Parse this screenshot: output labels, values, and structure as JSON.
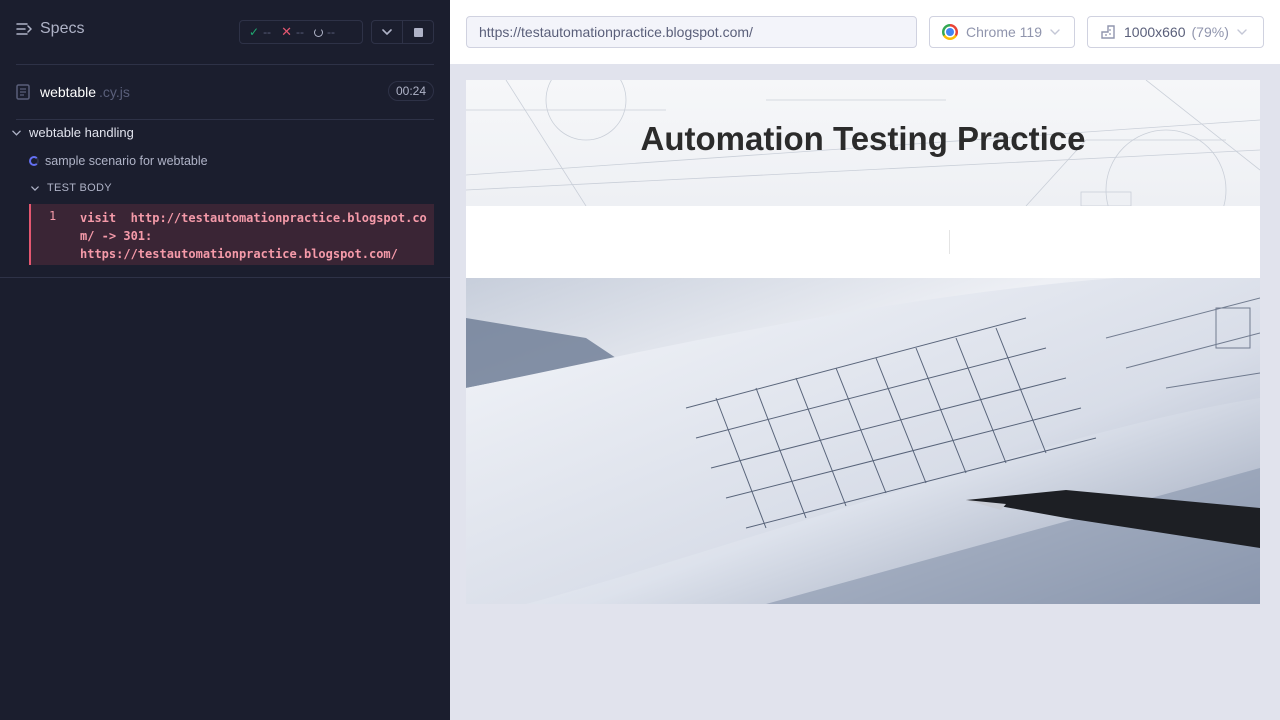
{
  "reporter": {
    "specs_label": "Specs",
    "stats": {
      "passed": "--",
      "failed": "--",
      "pending": "--"
    },
    "spec": {
      "name": "webtable",
      "ext": ".cy.js",
      "duration": "00:24"
    },
    "suite": {
      "title": "webtable handling"
    },
    "test": {
      "title": "sample scenario for webtable",
      "status": "running"
    },
    "hook": {
      "title": "TEST BODY"
    },
    "command": {
      "number": "1",
      "text": "visit  http://testautomationpractice.blogspot.co\nm/ -> 301:\nhttps://testautomationpractice.blogspot.com/"
    }
  },
  "app": {
    "url": "https://testautomationpractice.blogspot.com/",
    "browser": "Chrome 119",
    "viewport": "1000x660",
    "scale": "(79%)",
    "aut": {
      "site_title": "Automation Testing Practice"
    }
  },
  "colors": {
    "reporter_bg": "#1b1e2e",
    "pass": "#1fa971",
    "fail": "#e45770",
    "running": "#6470f3",
    "app_bg": "#e1e3ed"
  }
}
